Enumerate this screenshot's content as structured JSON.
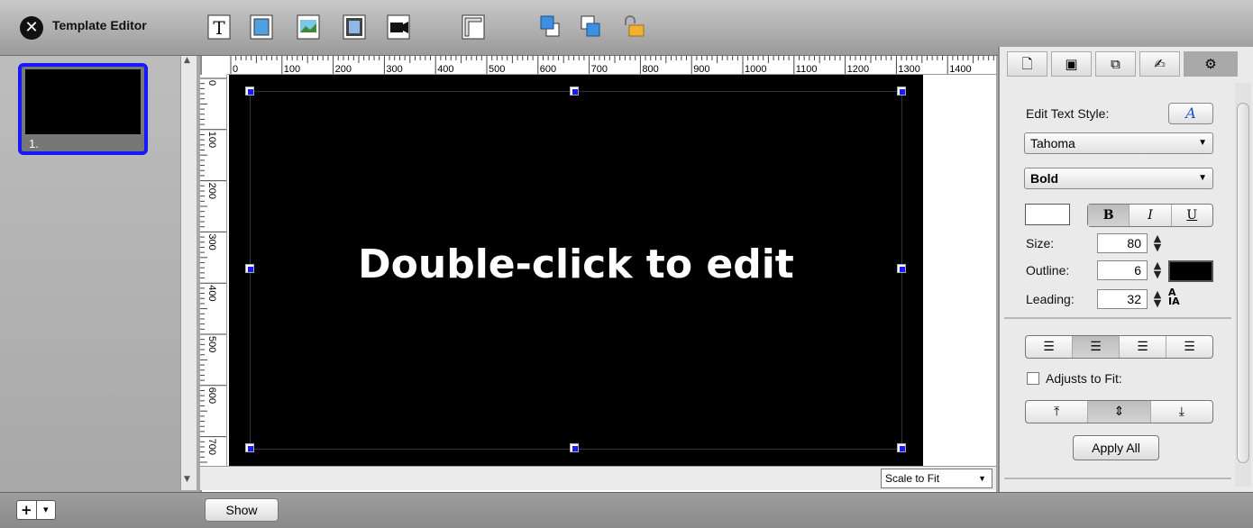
{
  "app": {
    "title": "Template Editor",
    "close_icon": "close-icon"
  },
  "toolbar": {
    "tools": [
      "text-box-icon",
      "shape-icon",
      "image-icon",
      "video-icon",
      "camera-icon",
      "ruler-toggle-icon",
      "bring-forward-icon",
      "send-backward-icon",
      "lock-icon"
    ]
  },
  "slides": [
    {
      "label": "1."
    }
  ],
  "ruler": {
    "top_labels": [
      "0",
      "100",
      "200",
      "300",
      "400",
      "500",
      "600",
      "700",
      "800",
      "900",
      "1000",
      "1100",
      "1200",
      "1300",
      "1400"
    ],
    "left_labels": [
      "0",
      "100",
      "200",
      "300",
      "400",
      "500",
      "600",
      "700"
    ]
  },
  "canvas": {
    "placeholder_text": "Double-click to edit",
    "scale_mode": "Scale to Fit"
  },
  "inspector": {
    "tabs": [
      "page-icon",
      "screen-icon",
      "layers-icon",
      "signature-icon",
      "gear-icon"
    ],
    "edit_text_style_label": "Edit Text Style:",
    "font_family": "Tahoma",
    "font_weight": "Bold",
    "style_buttons": [
      "B",
      "I",
      "U"
    ],
    "size_label": "Size:",
    "size_value": "80",
    "outline_label": "Outline:",
    "outline_value": "6",
    "leading_label": "Leading:",
    "leading_value": "32",
    "align_buttons": [
      "≡",
      "≡",
      "≡",
      "≡"
    ],
    "adjusts_label": "Adjusts to Fit:",
    "valign_buttons": [
      "⤒",
      "⇕",
      "⤓"
    ],
    "apply_all_label": "Apply All"
  },
  "bottom": {
    "show_label": "Show",
    "add_label": "+",
    "add_menu": "▾"
  }
}
